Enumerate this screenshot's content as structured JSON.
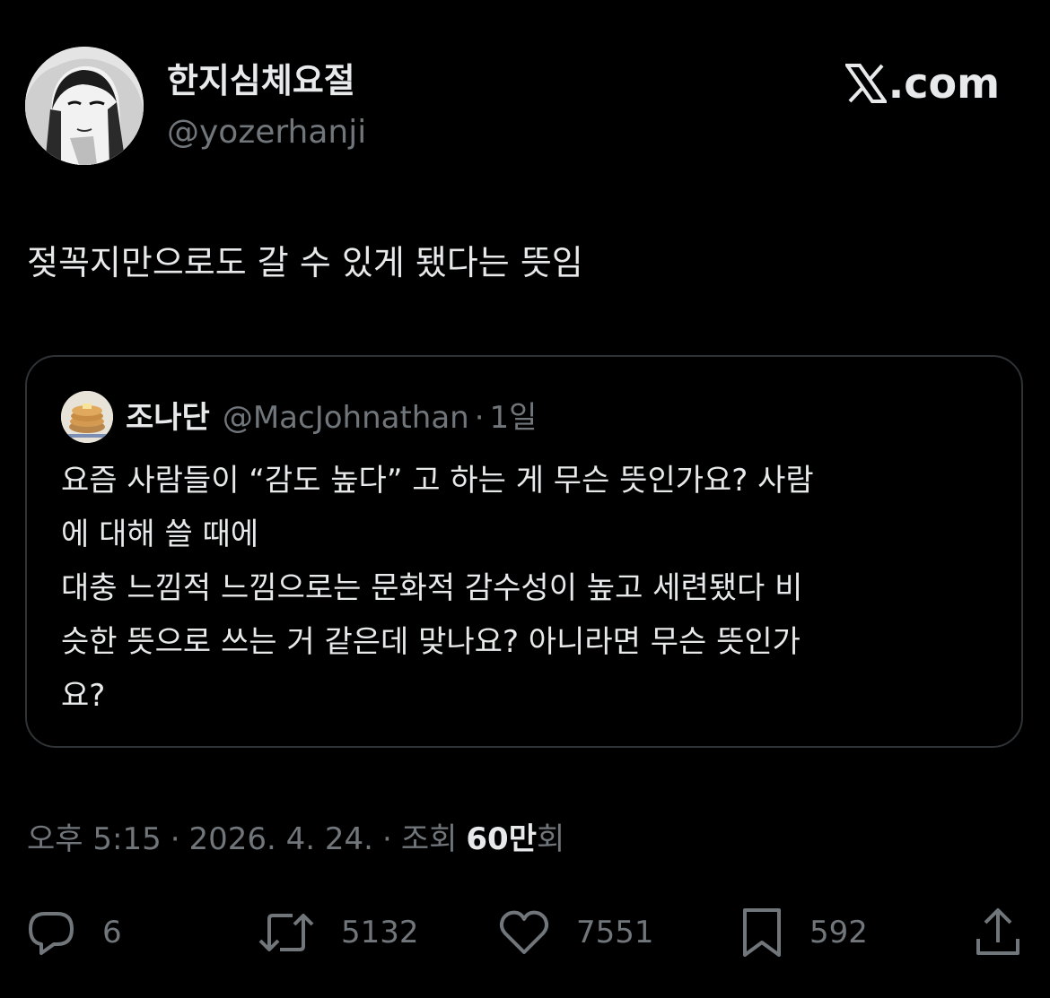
{
  "author": {
    "name": "한지심체요절",
    "handle": "@yozerhanji"
  },
  "site_mark": {
    "text": ".com",
    "icon": "x-logo-icon"
  },
  "tweet": {
    "text": "젖꼭지만으로도 갈 수 있게 됐다는 뜻임"
  },
  "quote": {
    "name": "조나단",
    "handle": "@MacJohnathan",
    "separator": "·",
    "age": "1일",
    "lines": [
      "요즘 사람들이 “감도 높다” 고 하는 게 무슨 뜻인가요? 사람",
      "에 대해 쓸 때에",
      "대충 느낌적 느낌으로는 문화적 감수성이 높고 세련됐다 비",
      "슷한 뜻으로 쓰는 거 같은데 맞나요? 아니라면 무슨 뜻인가",
      "요?"
    ]
  },
  "meta": {
    "time": "오후 5:15",
    "separator": "·",
    "date": "2026. 4. 24.",
    "views_prefix": "조회",
    "views_number": "60만",
    "views_suffix": "회"
  },
  "actions": {
    "reply": {
      "icon": "reply-icon",
      "count": "6"
    },
    "repost": {
      "icon": "repost-icon",
      "count": "5132"
    },
    "like": {
      "icon": "heart-icon",
      "count": "7551"
    },
    "bookmark": {
      "icon": "bookmark-icon",
      "count": "592"
    },
    "share": {
      "icon": "share-icon"
    }
  },
  "colors": {
    "background": "#000000",
    "primary_text": "#e7e9ea",
    "secondary_text": "#71767b",
    "border": "#2f3336"
  }
}
